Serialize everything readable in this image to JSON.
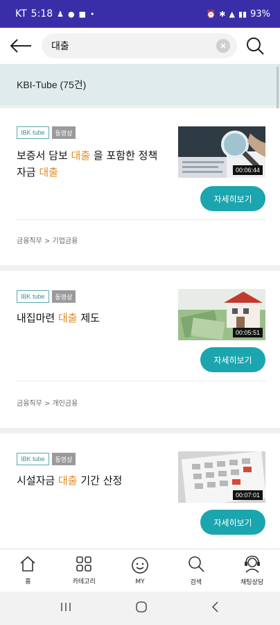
{
  "status_bar": {
    "carrier": "KT",
    "time": "5:18",
    "battery": "93%"
  },
  "search": {
    "query": "대출"
  },
  "section": {
    "title": "KBI-Tube (75건)"
  },
  "results": [
    {
      "badge_source": "IBK tube",
      "badge_type": "동영상",
      "title_parts": [
        "보증서 담보 ",
        "대출",
        " 을 포함한 정책 자금 ",
        "대출"
      ],
      "duration": "00:06:44",
      "detail_label": "자세히보기",
      "category": "금융직무 > 기업금융",
      "thumb_icon": "magnifier-documents-thumbnail"
    },
    {
      "badge_source": "IBK tube",
      "badge_type": "동영상",
      "title_parts": [
        "내집마련 ",
        "대출",
        " 제도"
      ],
      "duration": "00:05:51",
      "detail_label": "자세히보기",
      "category": "금융직무 > 개인금융",
      "thumb_icon": "house-money-thumbnail"
    },
    {
      "badge_source": "IBK tube",
      "badge_type": "동영상",
      "title_parts": [
        "시설자금 ",
        "대출",
        " 기간 산정"
      ],
      "duration": "00:07:01",
      "detail_label": "자세히보기",
      "category": "",
      "thumb_icon": "calendar-thumbnail"
    }
  ],
  "bottom_nav": [
    {
      "label": "홈",
      "icon": "home-icon"
    },
    {
      "label": "카테고리",
      "icon": "grid-icon"
    },
    {
      "label": "MY",
      "icon": "smiley-icon"
    },
    {
      "label": "검색",
      "icon": "search-icon"
    },
    {
      "label": "채팅상담",
      "icon": "headset-agent-icon"
    }
  ],
  "colors": {
    "accent": "#1ba5ae",
    "highlight": "#e08a23",
    "status_bar": "#3a2ea8",
    "section_bg": "#e0ebec"
  }
}
